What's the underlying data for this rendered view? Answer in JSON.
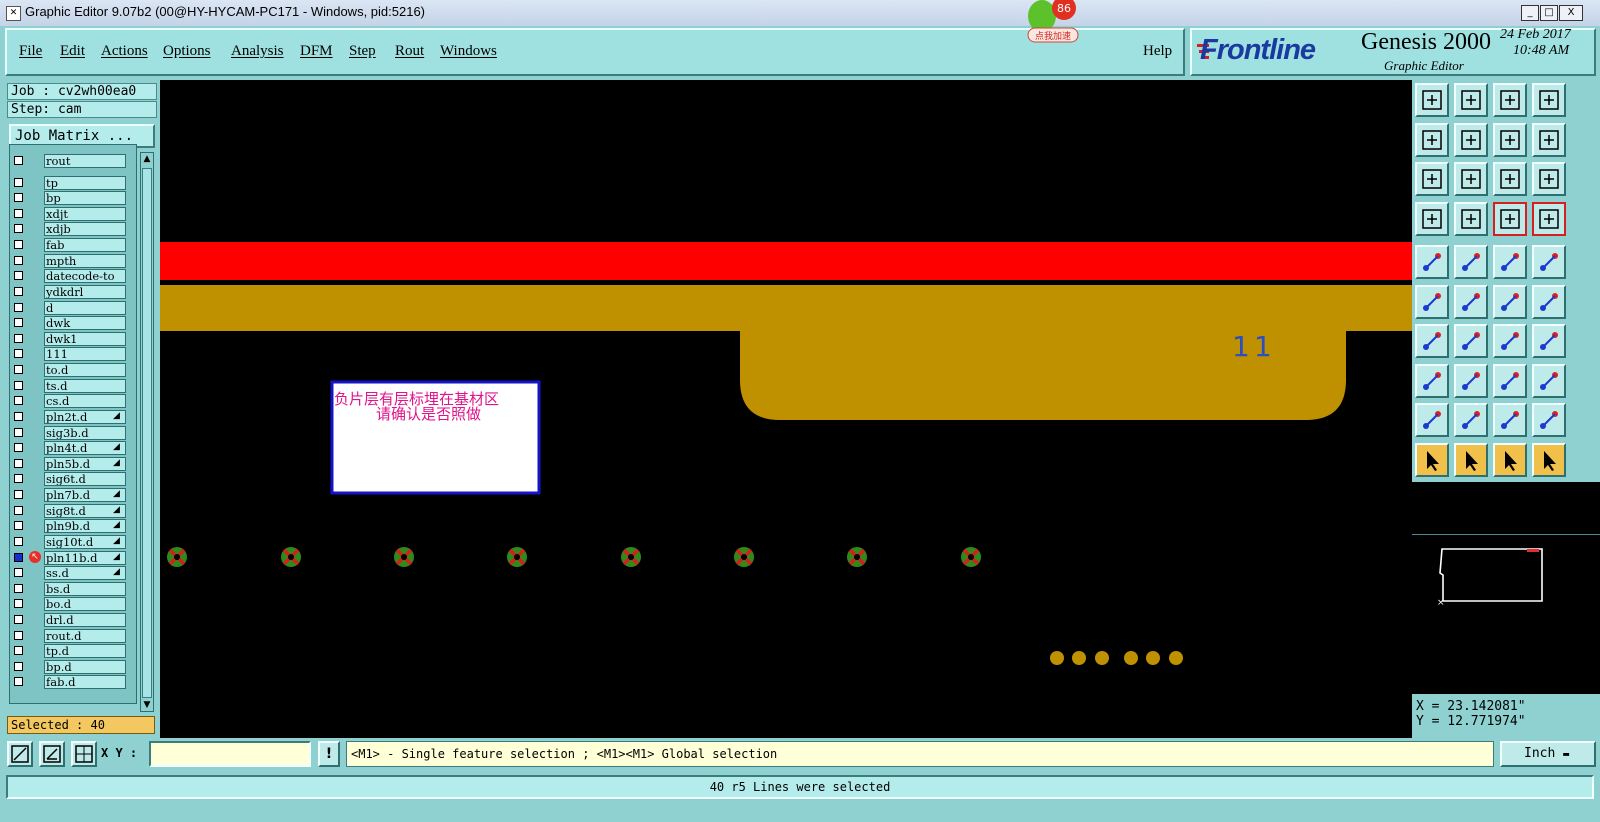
{
  "window": {
    "title": "Graphic Editor 9.07b2 (00@HY-HYCAM-PC171 - Windows, pid:5216)",
    "controls": [
      "_",
      "□",
      "X"
    ]
  },
  "overlay_badge": {
    "count": "86",
    "label": "点我加速"
  },
  "menu": {
    "items": [
      "File",
      "Edit",
      "Actions",
      "Options",
      "Analysis",
      "DFM",
      "Step",
      "Rout",
      "Windows"
    ],
    "help": "Help"
  },
  "brand": {
    "logo": "Frontline",
    "product": "Genesis 2000",
    "subtitle": "Graphic Editor",
    "date": "24 Feb 2017",
    "time": "10:48 AM"
  },
  "job": {
    "job_label": "Job : cv2wh00ea0",
    "step_label": "Step: cam",
    "matrix_button": "Job Matrix ..."
  },
  "layers": [
    {
      "name": "rout",
      "checked": false,
      "affected": false,
      "work": false
    },
    {
      "name": "tp",
      "checked": false,
      "affected": false,
      "work": false
    },
    {
      "name": "bp",
      "checked": false,
      "affected": false,
      "work": false
    },
    {
      "name": "xdjt",
      "checked": false,
      "affected": false,
      "work": false
    },
    {
      "name": "xdjb",
      "checked": false,
      "affected": false,
      "work": false
    },
    {
      "name": "fab",
      "checked": false,
      "affected": false,
      "work": false
    },
    {
      "name": "mpth",
      "checked": false,
      "affected": false,
      "work": false
    },
    {
      "name": "datecode-to",
      "checked": false,
      "affected": false,
      "work": false
    },
    {
      "name": "ydkdrl",
      "checked": false,
      "affected": false,
      "work": false
    },
    {
      "name": "d",
      "checked": false,
      "affected": false,
      "work": false
    },
    {
      "name": "dwk",
      "checked": false,
      "affected": false,
      "work": false
    },
    {
      "name": "dwk1",
      "checked": false,
      "affected": false,
      "work": false
    },
    {
      "name": "111",
      "checked": false,
      "affected": false,
      "work": false
    },
    {
      "name": "to.d",
      "checked": false,
      "affected": false,
      "work": false
    },
    {
      "name": "ts.d",
      "checked": false,
      "affected": false,
      "work": false
    },
    {
      "name": "cs.d",
      "checked": false,
      "affected": false,
      "work": false
    },
    {
      "name": "pln2t.d",
      "checked": false,
      "affected": true,
      "work": false
    },
    {
      "name": "sig3b.d",
      "checked": false,
      "affected": false,
      "work": false
    },
    {
      "name": "pln4t.d",
      "checked": false,
      "affected": true,
      "work": false
    },
    {
      "name": "pln5b.d",
      "checked": false,
      "affected": true,
      "work": false
    },
    {
      "name": "sig6t.d",
      "checked": false,
      "affected": false,
      "work": false
    },
    {
      "name": "pln7b.d",
      "checked": false,
      "affected": true,
      "work": false
    },
    {
      "name": "sig8t.d",
      "checked": false,
      "affected": true,
      "work": false
    },
    {
      "name": "pln9b.d",
      "checked": false,
      "affected": true,
      "work": false
    },
    {
      "name": "sig10t.d",
      "checked": false,
      "affected": true,
      "work": false
    },
    {
      "name": "pln11b.d",
      "checked": true,
      "affected": true,
      "work": true
    },
    {
      "name": "ss.d",
      "checked": false,
      "affected": true,
      "work": false
    },
    {
      "name": "bs.d",
      "checked": false,
      "affected": false,
      "work": false
    },
    {
      "name": "bo.d",
      "checked": false,
      "affected": false,
      "work": false
    },
    {
      "name": "drl.d",
      "checked": false,
      "affected": false,
      "work": false
    },
    {
      "name": "rout.d",
      "checked": false,
      "affected": false,
      "work": false
    },
    {
      "name": "tp.d",
      "checked": false,
      "affected": false,
      "work": false
    },
    {
      "name": "bp.d",
      "checked": false,
      "affected": false,
      "work": false
    },
    {
      "name": "fab.d",
      "checked": false,
      "affected": false,
      "work": false
    }
  ],
  "selected_count": "Selected : 40",
  "canvas": {
    "feature_label": "11",
    "note_line1": "负片层有层标埋在基材区",
    "note_line2": "请确认是否照做",
    "colors": {
      "red_band": "#ff0000",
      "copper": "#bf9100",
      "pad_green": "#2f8a1a",
      "pad_red": "#d42020",
      "note_text": "#e0148c",
      "note_border": "#1414c8",
      "label_blue": "#2b4fc0"
    }
  },
  "coordinates": {
    "x": "X = 23.142081\"",
    "y": "Y = 12.771974\""
  },
  "bottom": {
    "xy_label": "X Y :",
    "xy_value": "",
    "hint": "<M1> - Single feature selection ; <M1><M1> Global selection",
    "unit": "Inch",
    "status": "40 r5 Lines were selected"
  },
  "tools": [
    "open-step-icon",
    "save-icon",
    "home-icon",
    "window-icon",
    "fit-left-icon",
    "fit-right-icon",
    "zoom-back-icon",
    "redraw-icon",
    "zoom-fit-icon",
    "zoom-vertical-icon",
    "scale-1-2-icon",
    "help-icon",
    "measure-icon",
    "snap-pad-icon",
    "display-filter-icon",
    "display-graph-icon",
    "pad-tool-icon",
    "polygon-tool-icon",
    "ruler-icon",
    "circle-tool-icon",
    "connect-icon",
    "cross-icon",
    "move-point-icon",
    "select-point-icon",
    "line-tool-icon",
    "arrow-line-icon",
    "rotate-icon",
    "mirror-text-icon",
    "node-tool-icon",
    "cut-line-icon",
    "dimension-icon",
    "group-icon",
    "arc-tool-icon",
    "arc-up-icon",
    "arc-edit-icon",
    "arc-node-icon",
    "select-arrow-icon",
    "select-frame-icon",
    "select-rect-icon",
    "select-path-icon"
  ]
}
